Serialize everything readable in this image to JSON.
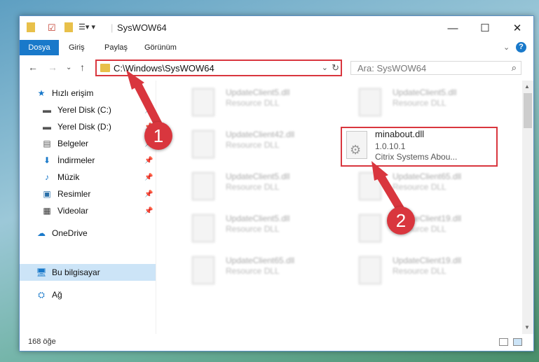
{
  "window": {
    "title": "SysWOW64",
    "minimize": "—",
    "maximize": "☐",
    "close": "✕"
  },
  "ribbon": {
    "tabs": [
      "Dosya",
      "Giriş",
      "Paylaş",
      "Görünüm"
    ],
    "help": "?"
  },
  "nav": {
    "address": "C:\\Windows\\SysWOW64",
    "search_placeholder": "Ara: SysWOW64"
  },
  "sidebar": {
    "items": [
      {
        "label": "Hızlı erişim",
        "icon": "star-icon"
      },
      {
        "label": "Yerel Disk (C:)",
        "icon": "drive-icon",
        "pinned": true
      },
      {
        "label": "Yerel Disk (D:)",
        "icon": "drive-icon",
        "pinned": true
      },
      {
        "label": "Belgeler",
        "icon": "document-icon",
        "pinned": true
      },
      {
        "label": "İndirmeler",
        "icon": "download-icon",
        "pinned": true
      },
      {
        "label": "Müzik",
        "icon": "music-icon",
        "pinned": true
      },
      {
        "label": "Resimler",
        "icon": "pictures-icon",
        "pinned": true
      },
      {
        "label": "Videolar",
        "icon": "video-icon",
        "pinned": true
      },
      {
        "label": "OneDrive",
        "icon": "cloud-icon"
      },
      {
        "label": "Bu bilgisayar",
        "icon": "computer-icon",
        "selected": true
      },
      {
        "label": "Ağ",
        "icon": "network-icon"
      }
    ]
  },
  "files": [
    {
      "name": "UpdateClient5.dll",
      "desc": "Resource DLL"
    },
    {
      "name": "UpdateClient5.dll",
      "desc": "Resource DLL"
    },
    {
      "name": "UpdateClient42.dll",
      "desc": "Resource DLL"
    },
    {
      "name": "minabout.dll",
      "version": "1.0.10.1",
      "desc": "Citrix Systems Abou..."
    },
    {
      "name": "UpdateClient5.dll",
      "desc": "Resource DLL"
    },
    {
      "name": "UpdateClient65.dll",
      "desc": "Resource DLL"
    },
    {
      "name": "UpdateClient5.dll",
      "desc": "Resource DLL"
    },
    {
      "name": "UpdateClient19.dll",
      "desc": "Resource DLL"
    },
    {
      "name": "UpdateClient65.dll",
      "desc": "Resource DLL"
    },
    {
      "name": "UpdateClient19.dll",
      "desc": "Resource DLL"
    }
  ],
  "status": {
    "count": "168 öğe"
  },
  "callouts": {
    "one": "1",
    "two": "2"
  },
  "colors": {
    "accent": "#1979ca",
    "highlight": "#d9363e"
  }
}
